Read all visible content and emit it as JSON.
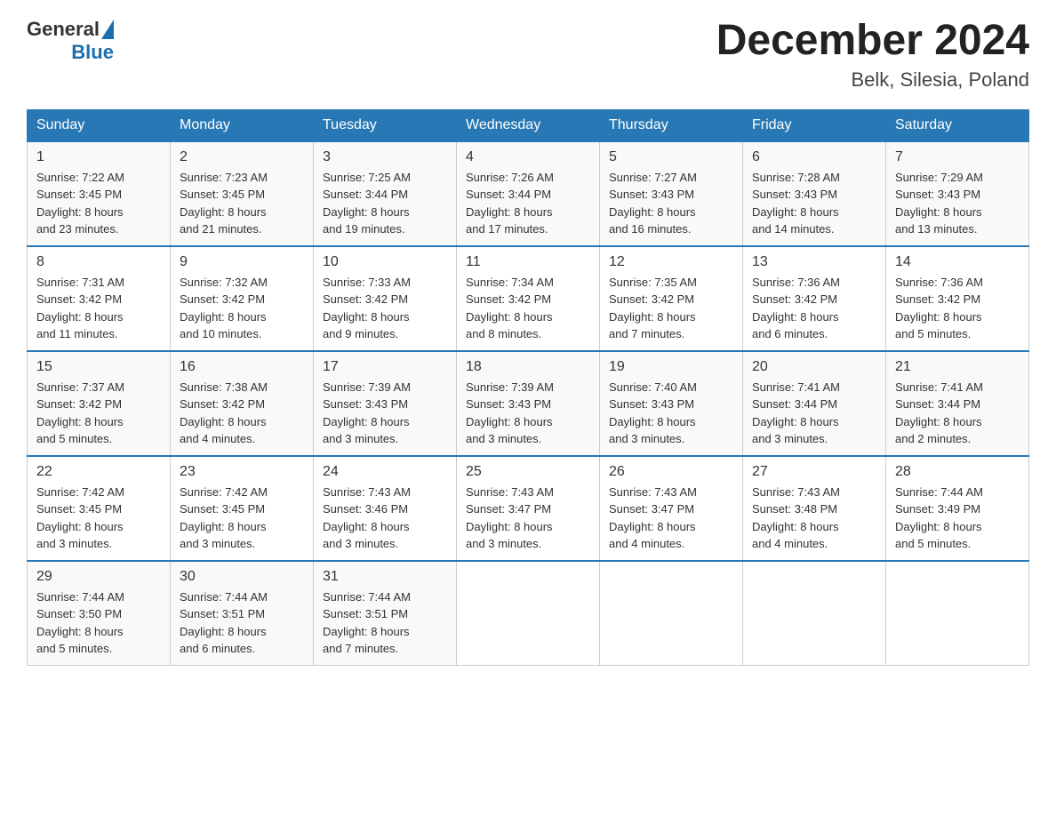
{
  "header": {
    "logo_general": "General",
    "logo_blue": "Blue",
    "title": "December 2024",
    "subtitle": "Belk, Silesia, Poland"
  },
  "days_of_week": [
    "Sunday",
    "Monday",
    "Tuesday",
    "Wednesday",
    "Thursday",
    "Friday",
    "Saturday"
  ],
  "weeks": [
    [
      {
        "day": "1",
        "sunrise": "7:22 AM",
        "sunset": "3:45 PM",
        "daylight": "8 hours and 23 minutes."
      },
      {
        "day": "2",
        "sunrise": "7:23 AM",
        "sunset": "3:45 PM",
        "daylight": "8 hours and 21 minutes."
      },
      {
        "day": "3",
        "sunrise": "7:25 AM",
        "sunset": "3:44 PM",
        "daylight": "8 hours and 19 minutes."
      },
      {
        "day": "4",
        "sunrise": "7:26 AM",
        "sunset": "3:44 PM",
        "daylight": "8 hours and 17 minutes."
      },
      {
        "day": "5",
        "sunrise": "7:27 AM",
        "sunset": "3:43 PM",
        "daylight": "8 hours and 16 minutes."
      },
      {
        "day": "6",
        "sunrise": "7:28 AM",
        "sunset": "3:43 PM",
        "daylight": "8 hours and 14 minutes."
      },
      {
        "day": "7",
        "sunrise": "7:29 AM",
        "sunset": "3:43 PM",
        "daylight": "8 hours and 13 minutes."
      }
    ],
    [
      {
        "day": "8",
        "sunrise": "7:31 AM",
        "sunset": "3:42 PM",
        "daylight": "8 hours and 11 minutes."
      },
      {
        "day": "9",
        "sunrise": "7:32 AM",
        "sunset": "3:42 PM",
        "daylight": "8 hours and 10 minutes."
      },
      {
        "day": "10",
        "sunrise": "7:33 AM",
        "sunset": "3:42 PM",
        "daylight": "8 hours and 9 minutes."
      },
      {
        "day": "11",
        "sunrise": "7:34 AM",
        "sunset": "3:42 PM",
        "daylight": "8 hours and 8 minutes."
      },
      {
        "day": "12",
        "sunrise": "7:35 AM",
        "sunset": "3:42 PM",
        "daylight": "8 hours and 7 minutes."
      },
      {
        "day": "13",
        "sunrise": "7:36 AM",
        "sunset": "3:42 PM",
        "daylight": "8 hours and 6 minutes."
      },
      {
        "day": "14",
        "sunrise": "7:36 AM",
        "sunset": "3:42 PM",
        "daylight": "8 hours and 5 minutes."
      }
    ],
    [
      {
        "day": "15",
        "sunrise": "7:37 AM",
        "sunset": "3:42 PM",
        "daylight": "8 hours and 5 minutes."
      },
      {
        "day": "16",
        "sunrise": "7:38 AM",
        "sunset": "3:42 PM",
        "daylight": "8 hours and 4 minutes."
      },
      {
        "day": "17",
        "sunrise": "7:39 AM",
        "sunset": "3:43 PM",
        "daylight": "8 hours and 3 minutes."
      },
      {
        "day": "18",
        "sunrise": "7:39 AM",
        "sunset": "3:43 PM",
        "daylight": "8 hours and 3 minutes."
      },
      {
        "day": "19",
        "sunrise": "7:40 AM",
        "sunset": "3:43 PM",
        "daylight": "8 hours and 3 minutes."
      },
      {
        "day": "20",
        "sunrise": "7:41 AM",
        "sunset": "3:44 PM",
        "daylight": "8 hours and 3 minutes."
      },
      {
        "day": "21",
        "sunrise": "7:41 AM",
        "sunset": "3:44 PM",
        "daylight": "8 hours and 2 minutes."
      }
    ],
    [
      {
        "day": "22",
        "sunrise": "7:42 AM",
        "sunset": "3:45 PM",
        "daylight": "8 hours and 3 minutes."
      },
      {
        "day": "23",
        "sunrise": "7:42 AM",
        "sunset": "3:45 PM",
        "daylight": "8 hours and 3 minutes."
      },
      {
        "day": "24",
        "sunrise": "7:43 AM",
        "sunset": "3:46 PM",
        "daylight": "8 hours and 3 minutes."
      },
      {
        "day": "25",
        "sunrise": "7:43 AM",
        "sunset": "3:47 PM",
        "daylight": "8 hours and 3 minutes."
      },
      {
        "day": "26",
        "sunrise": "7:43 AM",
        "sunset": "3:47 PM",
        "daylight": "8 hours and 4 minutes."
      },
      {
        "day": "27",
        "sunrise": "7:43 AM",
        "sunset": "3:48 PM",
        "daylight": "8 hours and 4 minutes."
      },
      {
        "day": "28",
        "sunrise": "7:44 AM",
        "sunset": "3:49 PM",
        "daylight": "8 hours and 5 minutes."
      }
    ],
    [
      {
        "day": "29",
        "sunrise": "7:44 AM",
        "sunset": "3:50 PM",
        "daylight": "8 hours and 5 minutes."
      },
      {
        "day": "30",
        "sunrise": "7:44 AM",
        "sunset": "3:51 PM",
        "daylight": "8 hours and 6 minutes."
      },
      {
        "day": "31",
        "sunrise": "7:44 AM",
        "sunset": "3:51 PM",
        "daylight": "8 hours and 7 minutes."
      },
      null,
      null,
      null,
      null
    ]
  ],
  "labels": {
    "sunrise": "Sunrise:",
    "sunset": "Sunset:",
    "daylight": "Daylight:"
  }
}
